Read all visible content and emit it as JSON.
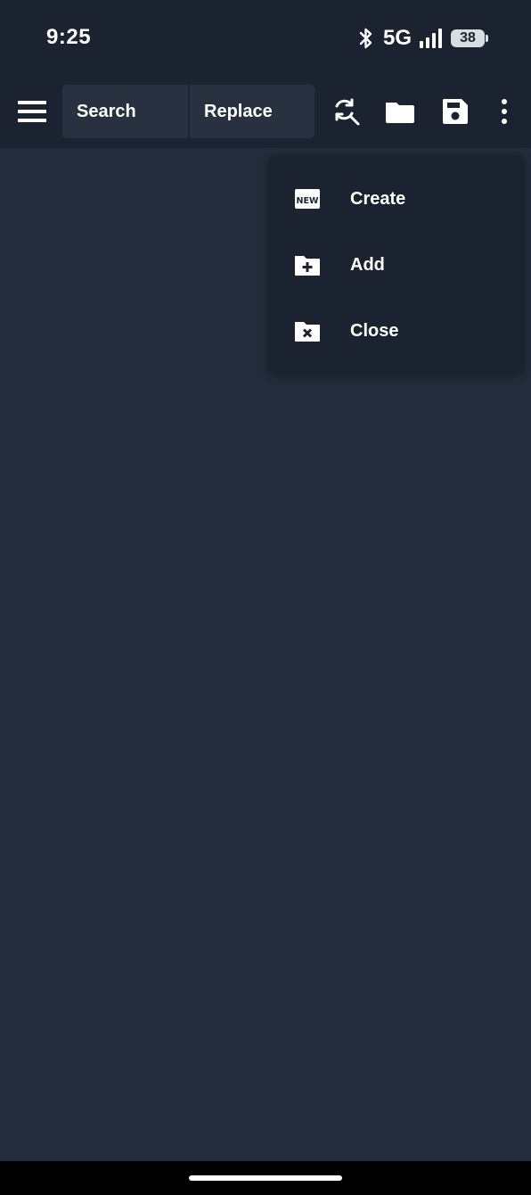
{
  "status_bar": {
    "time": "9:25",
    "network": "5G",
    "battery": "38",
    "icons": [
      "bluetooth-icon",
      "signal-icon",
      "battery-icon"
    ]
  },
  "toolbar": {
    "menu_icon": "hamburger-menu-icon",
    "search_placeholder": "Search",
    "replace_placeholder": "Replace",
    "icons": [
      "search-replace-icon",
      "folder-icon",
      "save-icon",
      "more-vert-icon"
    ]
  },
  "popup_menu": {
    "items": [
      {
        "label": "Create",
        "icon": "new-badge-icon"
      },
      {
        "label": "Add",
        "icon": "folder-add-icon"
      },
      {
        "label": "Close",
        "icon": "folder-close-icon"
      }
    ]
  },
  "colors": {
    "background": "#222c3a",
    "bars": "#1b2330",
    "field": "#27313f",
    "text": "#ffffff"
  }
}
